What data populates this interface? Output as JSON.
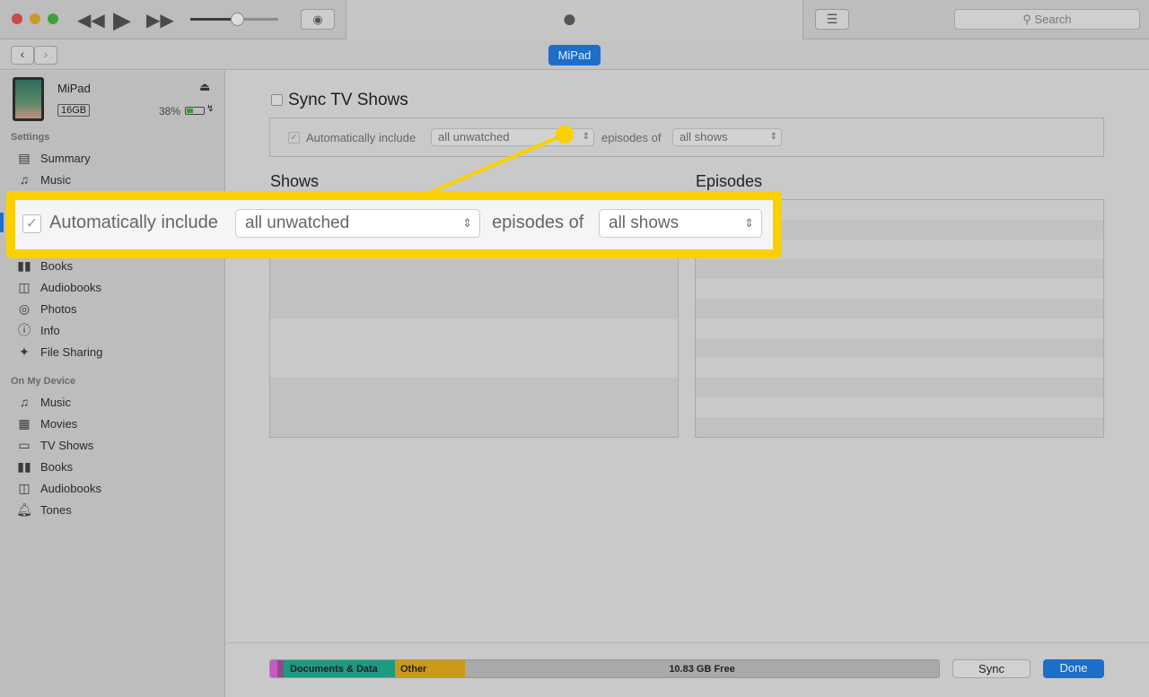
{
  "toolbar": {
    "search_placeholder": "Search",
    "apple_logo": "apple-icon"
  },
  "nav": {
    "device_badge": "MiPad"
  },
  "device": {
    "name": "MiPad",
    "capacity": "16GB",
    "battery": "38%",
    "battery_level": 0.38
  },
  "sidebar": {
    "settings_header": "Settings",
    "settings_items": [
      {
        "label": "Summary",
        "icon": "list-icon"
      },
      {
        "label": "Music",
        "icon": "music-note-icon"
      },
      {
        "label": "Books",
        "icon": "book-icon"
      },
      {
        "label": "Audiobooks",
        "icon": "audiobook-icon"
      },
      {
        "label": "Photos",
        "icon": "camera-icon"
      },
      {
        "label": "Info",
        "icon": "info-icon"
      },
      {
        "label": "File Sharing",
        "icon": "apps-icon"
      }
    ],
    "device_header": "On My Device",
    "device_items": [
      {
        "label": "Music",
        "icon": "music-note-icon"
      },
      {
        "label": "Movies",
        "icon": "film-icon"
      },
      {
        "label": "TV Shows",
        "icon": "tv-icon"
      },
      {
        "label": "Books",
        "icon": "book-icon"
      },
      {
        "label": "Audiobooks",
        "icon": "audiobook-icon"
      },
      {
        "label": "Tones",
        "icon": "bell-icon"
      }
    ]
  },
  "main": {
    "sync_label": "Sync TV Shows",
    "sync_checked": false,
    "auto_include_label": "Automatically include",
    "auto_include_checked": true,
    "episodes_select": "all unwatched",
    "episodes_of_label": "episodes of",
    "shows_select": "all shows",
    "shows_header": "Shows",
    "episodes_header": "Episodes"
  },
  "callout": {
    "auto_include_label": "Automatically include",
    "episodes_select": "all unwatched",
    "episodes_of_label": "episodes of",
    "shows_select": "all shows",
    "color": "#fcd000"
  },
  "storage": {
    "segments": [
      {
        "label": "",
        "color": "#c25bc4"
      },
      {
        "label": "",
        "color": "#8a4d8a"
      },
      {
        "label": "Documents & Data",
        "color": "#1f9a82"
      },
      {
        "label": "Other",
        "color": "#c99a1a"
      }
    ],
    "free": "10.83 GB Free"
  },
  "buttons": {
    "sync": "Sync",
    "done": "Done"
  }
}
